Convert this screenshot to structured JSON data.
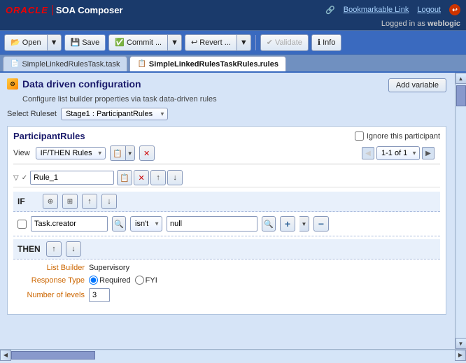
{
  "app": {
    "oracle_label": "ORACLE",
    "soa_label": "SOA Composer"
  },
  "toplinks": {
    "bookmarkable": "Bookmarkable Link",
    "logout": "Logout",
    "logged_in": "Logged in as",
    "user": "weblogic"
  },
  "toolbar": {
    "open_label": "Open",
    "save_label": "Save",
    "commit_label": "Commit ...",
    "revert_label": "Revert ...",
    "validate_label": "Validate",
    "info_label": "Info"
  },
  "tabs": [
    {
      "id": "task",
      "label": "SimpleLinkedRulesTask.task",
      "active": false
    },
    {
      "id": "rules",
      "label": "SimpleLinkedRulesTaskRules.rules",
      "active": true
    }
  ],
  "content": {
    "title": "Data driven configuration",
    "description": "Configure list builder properties via task data-driven rules",
    "add_variable_btn": "Add variable",
    "select_ruleset_label": "Select Ruleset",
    "ruleset_value": "Stage1 : ParticipantRules"
  },
  "rules_panel": {
    "title": "ParticipantRules",
    "ignore_label": "Ignore this participant",
    "view_label": "View",
    "view_value": "IF/THEN Rules",
    "page_range": "1-1 of 1",
    "rule_name": "Rule_1",
    "if_label": "IF",
    "condition": {
      "field": "Task.creator",
      "operator": "isn't",
      "value": "null"
    },
    "then_label": "THEN",
    "list_builder_label": "List Builder",
    "list_builder_value": "Supervisory",
    "response_type_label": "Response Type",
    "response_required": "Required",
    "response_fyi": "FYI",
    "levels_label": "Number of levels",
    "levels_value": "3"
  }
}
